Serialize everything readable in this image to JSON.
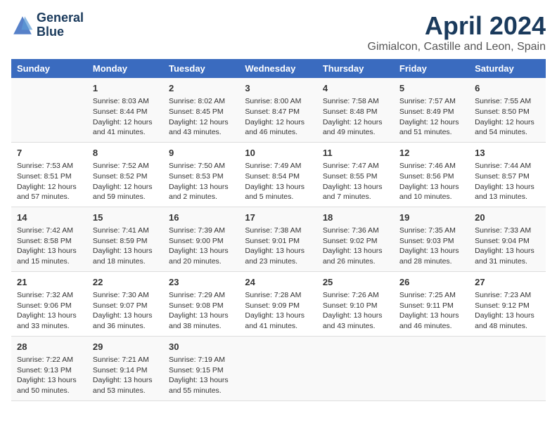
{
  "header": {
    "logo_line1": "General",
    "logo_line2": "Blue",
    "title": "April 2024",
    "subtitle": "Gimialcon, Castille and Leon, Spain"
  },
  "calendar": {
    "days_of_week": [
      "Sunday",
      "Monday",
      "Tuesday",
      "Wednesday",
      "Thursday",
      "Friday",
      "Saturday"
    ],
    "weeks": [
      [
        {
          "day": "",
          "info": ""
        },
        {
          "day": "1",
          "info": "Sunrise: 8:03 AM\nSunset: 8:44 PM\nDaylight: 12 hours\nand 41 minutes."
        },
        {
          "day": "2",
          "info": "Sunrise: 8:02 AM\nSunset: 8:45 PM\nDaylight: 12 hours\nand 43 minutes."
        },
        {
          "day": "3",
          "info": "Sunrise: 8:00 AM\nSunset: 8:47 PM\nDaylight: 12 hours\nand 46 minutes."
        },
        {
          "day": "4",
          "info": "Sunrise: 7:58 AM\nSunset: 8:48 PM\nDaylight: 12 hours\nand 49 minutes."
        },
        {
          "day": "5",
          "info": "Sunrise: 7:57 AM\nSunset: 8:49 PM\nDaylight: 12 hours\nand 51 minutes."
        },
        {
          "day": "6",
          "info": "Sunrise: 7:55 AM\nSunset: 8:50 PM\nDaylight: 12 hours\nand 54 minutes."
        }
      ],
      [
        {
          "day": "7",
          "info": "Sunrise: 7:53 AM\nSunset: 8:51 PM\nDaylight: 12 hours\nand 57 minutes."
        },
        {
          "day": "8",
          "info": "Sunrise: 7:52 AM\nSunset: 8:52 PM\nDaylight: 12 hours\nand 59 minutes."
        },
        {
          "day": "9",
          "info": "Sunrise: 7:50 AM\nSunset: 8:53 PM\nDaylight: 13 hours\nand 2 minutes."
        },
        {
          "day": "10",
          "info": "Sunrise: 7:49 AM\nSunset: 8:54 PM\nDaylight: 13 hours\nand 5 minutes."
        },
        {
          "day": "11",
          "info": "Sunrise: 7:47 AM\nSunset: 8:55 PM\nDaylight: 13 hours\nand 7 minutes."
        },
        {
          "day": "12",
          "info": "Sunrise: 7:46 AM\nSunset: 8:56 PM\nDaylight: 13 hours\nand 10 minutes."
        },
        {
          "day": "13",
          "info": "Sunrise: 7:44 AM\nSunset: 8:57 PM\nDaylight: 13 hours\nand 13 minutes."
        }
      ],
      [
        {
          "day": "14",
          "info": "Sunrise: 7:42 AM\nSunset: 8:58 PM\nDaylight: 13 hours\nand 15 minutes."
        },
        {
          "day": "15",
          "info": "Sunrise: 7:41 AM\nSunset: 8:59 PM\nDaylight: 13 hours\nand 18 minutes."
        },
        {
          "day": "16",
          "info": "Sunrise: 7:39 AM\nSunset: 9:00 PM\nDaylight: 13 hours\nand 20 minutes."
        },
        {
          "day": "17",
          "info": "Sunrise: 7:38 AM\nSunset: 9:01 PM\nDaylight: 13 hours\nand 23 minutes."
        },
        {
          "day": "18",
          "info": "Sunrise: 7:36 AM\nSunset: 9:02 PM\nDaylight: 13 hours\nand 26 minutes."
        },
        {
          "day": "19",
          "info": "Sunrise: 7:35 AM\nSunset: 9:03 PM\nDaylight: 13 hours\nand 28 minutes."
        },
        {
          "day": "20",
          "info": "Sunrise: 7:33 AM\nSunset: 9:04 PM\nDaylight: 13 hours\nand 31 minutes."
        }
      ],
      [
        {
          "day": "21",
          "info": "Sunrise: 7:32 AM\nSunset: 9:06 PM\nDaylight: 13 hours\nand 33 minutes."
        },
        {
          "day": "22",
          "info": "Sunrise: 7:30 AM\nSunset: 9:07 PM\nDaylight: 13 hours\nand 36 minutes."
        },
        {
          "day": "23",
          "info": "Sunrise: 7:29 AM\nSunset: 9:08 PM\nDaylight: 13 hours\nand 38 minutes."
        },
        {
          "day": "24",
          "info": "Sunrise: 7:28 AM\nSunset: 9:09 PM\nDaylight: 13 hours\nand 41 minutes."
        },
        {
          "day": "25",
          "info": "Sunrise: 7:26 AM\nSunset: 9:10 PM\nDaylight: 13 hours\nand 43 minutes."
        },
        {
          "day": "26",
          "info": "Sunrise: 7:25 AM\nSunset: 9:11 PM\nDaylight: 13 hours\nand 46 minutes."
        },
        {
          "day": "27",
          "info": "Sunrise: 7:23 AM\nSunset: 9:12 PM\nDaylight: 13 hours\nand 48 minutes."
        }
      ],
      [
        {
          "day": "28",
          "info": "Sunrise: 7:22 AM\nSunset: 9:13 PM\nDaylight: 13 hours\nand 50 minutes."
        },
        {
          "day": "29",
          "info": "Sunrise: 7:21 AM\nSunset: 9:14 PM\nDaylight: 13 hours\nand 53 minutes."
        },
        {
          "day": "30",
          "info": "Sunrise: 7:19 AM\nSunset: 9:15 PM\nDaylight: 13 hours\nand 55 minutes."
        },
        {
          "day": "",
          "info": ""
        },
        {
          "day": "",
          "info": ""
        },
        {
          "day": "",
          "info": ""
        },
        {
          "day": "",
          "info": ""
        }
      ]
    ]
  }
}
